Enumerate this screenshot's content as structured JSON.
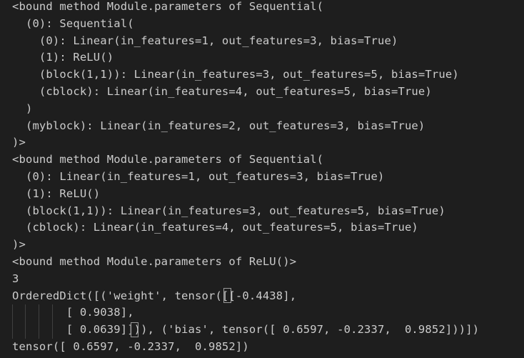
{
  "output_lines": [
    "<bound method Module.parameters of Sequential(",
    "  (0): Sequential(",
    "    (0): Linear(in_features=1, out_features=3, bias=True)",
    "    (1): ReLU()",
    "    (block(1,1)): Linear(in_features=3, out_features=5, bias=True)",
    "    (cblock): Linear(in_features=4, out_features=5, bias=True)",
    "  )",
    "  (myblock): Linear(in_features=2, out_features=3, bias=True)",
    ")>",
    "<bound method Module.parameters of Sequential(",
    "  (0): Linear(in_features=1, out_features=3, bias=True)",
    "  (1): ReLU()",
    "  (block(1,1)): Linear(in_features=3, out_features=5, bias=True)",
    "  (cblock): Linear(in_features=4, out_features=5, bias=True)",
    ")>",
    "<bound method Module.parameters of ReLU()>",
    "3",
    "OrderedDict([('weight', tensor([[-0.4438],",
    "        [ 0.9038],",
    "        [ 0.0639]])), ('bias', tensor([ 0.6597, -0.2337,  0.9852]))])",
    "tensor([ 0.6597, -0.2337,  0.9852])"
  ],
  "colors": {
    "background": "#1e1e1e",
    "text": "#cccccc",
    "indent_guide": "#404040",
    "bracket_highlight": "#9a9a9a"
  }
}
